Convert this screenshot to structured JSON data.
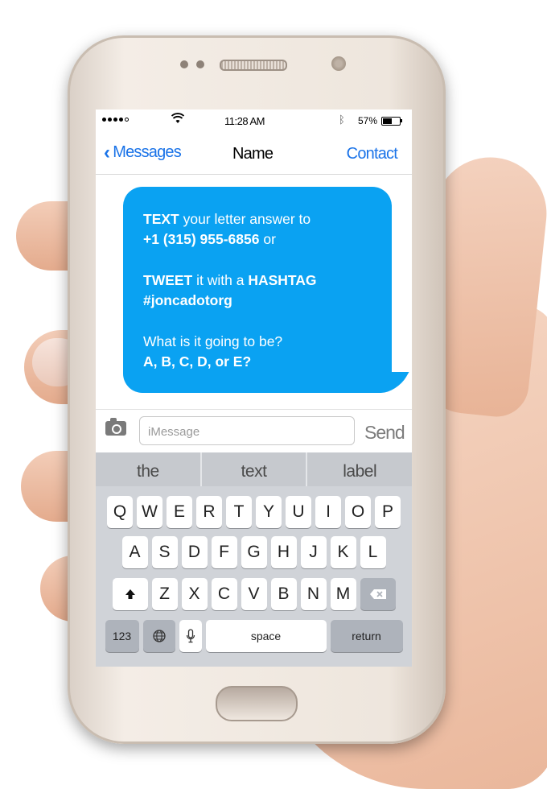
{
  "status_bar": {
    "signal": "●●●●○",
    "wifi_icon": "wifi-icon",
    "time": "11:28 AM",
    "bluetooth_icon": "bluetooth-icon",
    "battery_percent": "57%",
    "battery_level": 0.57
  },
  "nav": {
    "back_label": "Messages",
    "title": "Name",
    "contact_label": "Contact"
  },
  "message": {
    "line1_bold": "TEXT",
    "line1_rest": " your letter answer to",
    "line2_bold": "+1 (315) 955-6856",
    "line2_rest": " or",
    "line3_bold1": "TWEET",
    "line3_mid": " it with a ",
    "line3_bold2": "HASHTAG",
    "line4_bold": "#joncadotorg",
    "line5": "What is it going to be?",
    "line6_bold": "A, B, C, D, or E?"
  },
  "input": {
    "placeholder": "iMessage",
    "send_label": "Send"
  },
  "keyboard": {
    "suggestions": [
      "the",
      "text",
      "label"
    ],
    "row1": [
      "Q",
      "W",
      "E",
      "R",
      "T",
      "Y",
      "U",
      "I",
      "O",
      "P"
    ],
    "row2": [
      "A",
      "S",
      "D",
      "F",
      "G",
      "H",
      "J",
      "K",
      "L"
    ],
    "row3": [
      "Z",
      "X",
      "C",
      "V",
      "B",
      "N",
      "M"
    ],
    "numbers_label": "123",
    "space_label": "space",
    "return_label": "return"
  },
  "colors": {
    "bubble": "#0aa2f2",
    "link": "#1a73e8"
  }
}
